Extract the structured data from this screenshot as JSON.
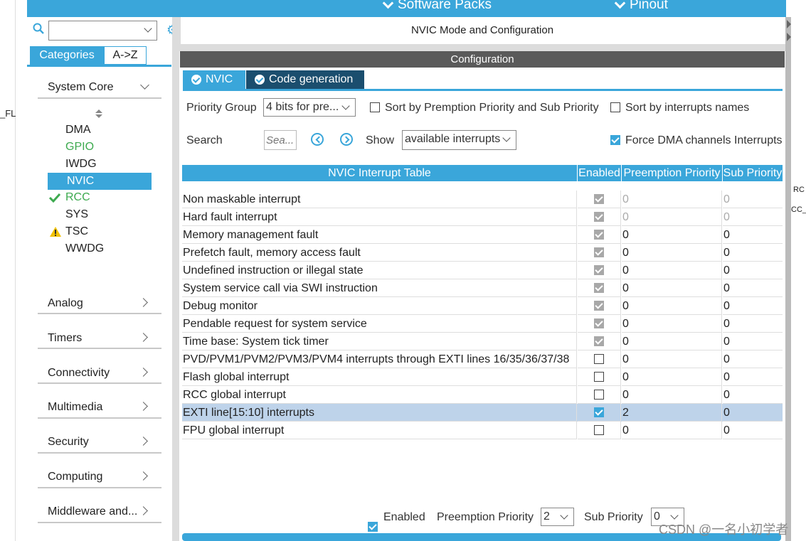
{
  "header": {
    "software_packs": "Software Packs",
    "pinout": "Pinout"
  },
  "left_strip_text": "_FL",
  "sidebar": {
    "search_value": "",
    "tabs": [
      "Categories",
      "A->Z"
    ],
    "system_core": {
      "label": "System Core",
      "items": [
        {
          "label": "DMA",
          "status": ""
        },
        {
          "label": "GPIO",
          "status": "green"
        },
        {
          "label": "IWDG",
          "status": ""
        },
        {
          "label": "NVIC",
          "status": "selected"
        },
        {
          "label": "RCC",
          "status": "check"
        },
        {
          "label": "SYS",
          "status": ""
        },
        {
          "label": "TSC",
          "status": "warning"
        },
        {
          "label": "WWDG",
          "status": ""
        }
      ]
    },
    "categories": [
      "Analog",
      "Timers",
      "Connectivity",
      "Multimedia",
      "Security",
      "Computing",
      "Middleware and..."
    ]
  },
  "main": {
    "title": "NVIC Mode and Configuration",
    "config_header": "Configuration",
    "tabs": [
      "NVIC",
      "Code generation"
    ],
    "priority_group_label": "Priority Group",
    "priority_group_value": "4 bits for pre...",
    "sort_premption_label": "Sort by Premption Priority and Sub Priority",
    "sort_names_label": "Sort by interrupts names",
    "search_label": "Search",
    "search_placeholder": "Sea...",
    "show_label": "Show",
    "show_value": "available interrupts",
    "force_dma_label": "Force DMA channels Interrupts",
    "table": {
      "headers": [
        "NVIC Interrupt Table",
        "Enabled",
        "Preemption Priority",
        "Sub Priority"
      ],
      "rows": [
        {
          "name": "Non maskable interrupt",
          "enabled": "locked",
          "pp": "0",
          "sp": "0",
          "muted": true
        },
        {
          "name": "Hard fault interrupt",
          "enabled": "locked",
          "pp": "0",
          "sp": "0",
          "muted": true
        },
        {
          "name": "Memory management fault",
          "enabled": "locked",
          "pp": "0",
          "sp": "0",
          "muted": false
        },
        {
          "name": "Prefetch fault, memory access fault",
          "enabled": "locked",
          "pp": "0",
          "sp": "0",
          "muted": false
        },
        {
          "name": "Undefined instruction or illegal state",
          "enabled": "locked",
          "pp": "0",
          "sp": "0",
          "muted": false
        },
        {
          "name": "System service call via SWI instruction",
          "enabled": "locked",
          "pp": "0",
          "sp": "0",
          "muted": false
        },
        {
          "name": "Debug monitor",
          "enabled": "locked",
          "pp": "0",
          "sp": "0",
          "muted": false
        },
        {
          "name": "Pendable request for system service",
          "enabled": "locked",
          "pp": "0",
          "sp": "0",
          "muted": false
        },
        {
          "name": "Time base: System tick timer",
          "enabled": "locked",
          "pp": "0",
          "sp": "0",
          "muted": false
        },
        {
          "name": "PVD/PVM1/PVM2/PVM3/PVM4 interrupts through EXTI lines 16/35/36/37/38",
          "enabled": "off",
          "pp": "0",
          "sp": "0",
          "muted": false
        },
        {
          "name": "Flash global interrupt",
          "enabled": "off",
          "pp": "0",
          "sp": "0",
          "muted": false
        },
        {
          "name": "RCC global interrupt",
          "enabled": "off",
          "pp": "0",
          "sp": "0",
          "muted": false
        },
        {
          "name": "EXTI line[15:10] interrupts",
          "enabled": "on",
          "pp": "2",
          "sp": "0",
          "muted": false,
          "selected": true
        },
        {
          "name": "FPU global interrupt",
          "enabled": "off",
          "pp": "0",
          "sp": "0",
          "muted": false
        }
      ]
    },
    "bottom": {
      "enabled_label": "Enabled",
      "pp_label": "Preemption Priority",
      "pp_value": "2",
      "sp_label": "Sub Priority",
      "sp_value": "0"
    },
    "right_fragments": [
      "RC",
      "CC_"
    ]
  },
  "watermark": "CSDN @一名小初学者",
  "colors": {
    "accent": "#3aa6da",
    "dark_tab": "#1b4e6e",
    "config_bar": "#5a5a5a",
    "selected_row": "#bed3ea",
    "gpio_green": "#3daa4f",
    "warning": "#f2c200"
  }
}
